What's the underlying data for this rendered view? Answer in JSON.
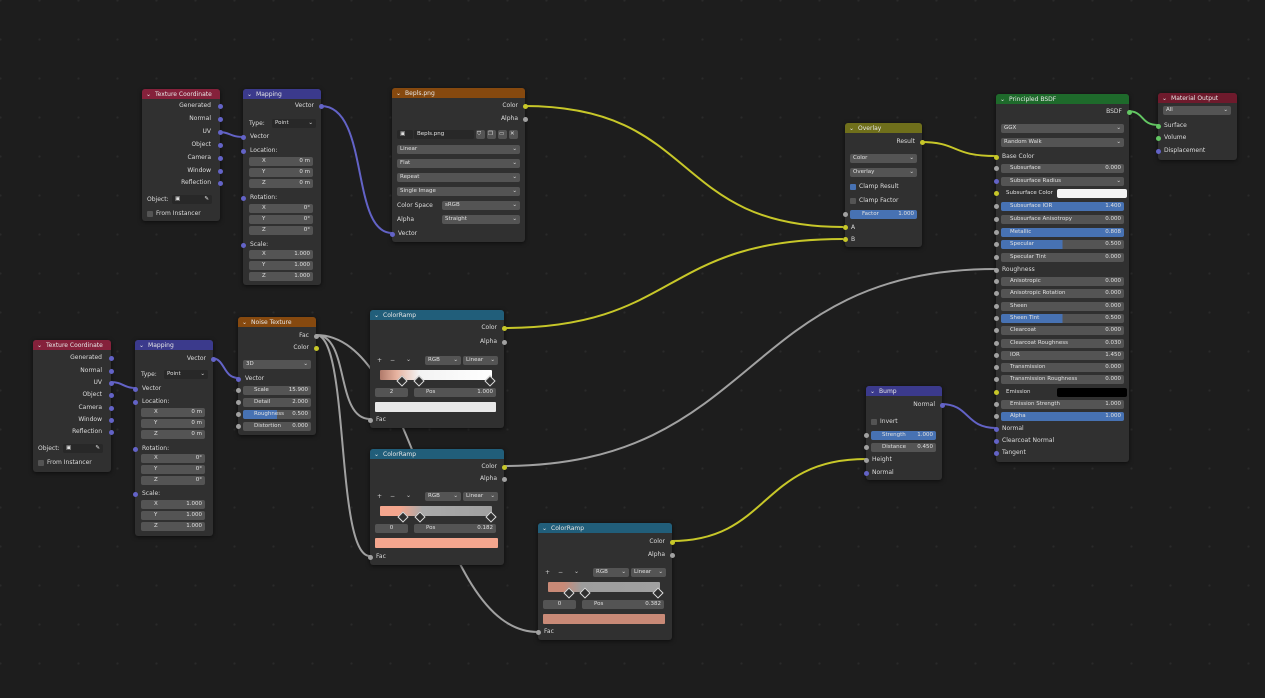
{
  "nodes": {
    "tc1": {
      "title": "Texture Coordinate",
      "outputs": [
        "Generated",
        "Normal",
        "UV",
        "Object",
        "Camera",
        "Window",
        "Reflection"
      ],
      "object_label": "Object:",
      "from_instancer": "From Instancer"
    },
    "mp1": {
      "title": "Mapping",
      "output": "Vector",
      "type_label": "Type:",
      "type_value": "Point",
      "input": "Vector",
      "location": "Location:",
      "rotation": "Rotation:",
      "scale": "Scale:",
      "loc": [
        [
          "X",
          "0 m"
        ],
        [
          "Y",
          "0 m"
        ],
        [
          "Z",
          "0 m"
        ]
      ],
      "rot": [
        [
          "X",
          "0°"
        ],
        [
          "Y",
          "0°"
        ],
        [
          "Z",
          "0°"
        ]
      ],
      "scl": [
        [
          "X",
          "1.000"
        ],
        [
          "Y",
          "1.000"
        ],
        [
          "Z",
          "1.000"
        ]
      ]
    },
    "img": {
      "title": "Bepls.png",
      "out_color": "Color",
      "out_alpha": "Alpha",
      "image_name": "Bepls.png",
      "interp": "Linear",
      "proj": "Flat",
      "ext": "Repeat",
      "source": "Single Image",
      "cs_label": "Color Space",
      "cs_value": "sRGB",
      "alpha_label": "Alpha",
      "alpha_value": "Straight",
      "input": "Vector"
    },
    "overlay": {
      "title": "Overlay",
      "out": "Result",
      "mode1": "Color",
      "mode2": "Overlay",
      "clamp_result": "Clamp Result",
      "clamp_factor": "Clamp Factor",
      "factor_label": "Factor",
      "factor_value": "1.000",
      "in_a": "A",
      "in_b": "B"
    },
    "bsdf": {
      "title": "Principled BSDF",
      "out": "BSDF",
      "dist": "GGX",
      "sss_method": "Random Walk",
      "base_color": "Base Color",
      "rows": [
        [
          "Subsurface",
          "0.000",
          "n"
        ],
        [
          "Subsurface Radius",
          "",
          "d"
        ],
        [
          "Subsurface Color",
          "",
          "w"
        ],
        [
          "Subsurface IOR",
          "1.400",
          "b"
        ],
        [
          "Subsurface Anisotropy",
          "0.000",
          "n"
        ],
        [
          "Metallic",
          "0.808",
          "b"
        ],
        [
          "Specular",
          "0.500",
          "h"
        ],
        [
          "Specular Tint",
          "0.000",
          "n"
        ]
      ],
      "roughness": "Roughness",
      "rows2": [
        [
          "Anisotropic",
          "0.000",
          "n"
        ],
        [
          "Anisotropic Rotation",
          "0.000",
          "n"
        ],
        [
          "Sheen",
          "0.000",
          "n"
        ],
        [
          "Sheen Tint",
          "0.500",
          "h"
        ],
        [
          "Clearcoat",
          "0.000",
          "n"
        ],
        [
          "Clearcoat Roughness",
          "0.030",
          "n"
        ],
        [
          "IOR",
          "1.450",
          "n"
        ],
        [
          "Transmission",
          "0.000",
          "n"
        ],
        [
          "Transmission Roughness",
          "0.000",
          "n"
        ],
        [
          "Emission",
          "",
          "k"
        ],
        [
          "Emission Strength",
          "1.000",
          "n"
        ],
        [
          "Alpha",
          "1.000",
          "b"
        ]
      ],
      "normal": "Normal",
      "clearcoat_normal": "Clearcoat Normal",
      "tangent": "Tangent"
    },
    "matout": {
      "title": "Material Output",
      "target": "All",
      "surface": "Surface",
      "volume": "Volume",
      "displacement": "Displacement"
    },
    "tc2": {
      "title": "Texture Coordinate",
      "outputs": [
        "Generated",
        "Normal",
        "UV",
        "Object",
        "Camera",
        "Window",
        "Reflection"
      ],
      "object_label": "Object:",
      "from_instancer": "From Instancer"
    },
    "mp2": {
      "title": "Mapping",
      "output": "Vector",
      "type_label": "Type:",
      "type_value": "Point",
      "input": "Vector",
      "location": "Location:",
      "rotation": "Rotation:",
      "scale": "Scale:",
      "loc": [
        [
          "X",
          "0 m"
        ],
        [
          "Y",
          "0 m"
        ],
        [
          "Z",
          "0 m"
        ]
      ],
      "rot": [
        [
          "X",
          "0°"
        ],
        [
          "Y",
          "0°"
        ],
        [
          "Z",
          "0°"
        ]
      ],
      "scl": [
        [
          "X",
          "1.000"
        ],
        [
          "Y",
          "1.000"
        ],
        [
          "Z",
          "1.000"
        ]
      ]
    },
    "noise": {
      "title": "Noise Texture",
      "out_fac": "Fac",
      "out_color": "Color",
      "dim": "3D",
      "input": "Vector",
      "scale": [
        "Scale",
        "15.900"
      ],
      "detail": [
        "Detail",
        "2.000"
      ],
      "roughness": [
        "Roughness",
        "0.500"
      ],
      "distortion": [
        "Distortion",
        "0.000"
      ]
    },
    "ramp1": {
      "title": "ColorRamp",
      "out_color": "Color",
      "out_alpha": "Alpha",
      "mode": "RGB",
      "interp": "Linear",
      "index": "2",
      "pos_label": "Pos",
      "pos_value": "1.000",
      "input": "Fac"
    },
    "ramp2": {
      "title": "ColorRamp",
      "out_color": "Color",
      "out_alpha": "Alpha",
      "mode": "RGB",
      "interp": "Linear",
      "index": "0",
      "pos_label": "Pos",
      "pos_value": "0.182",
      "input": "Fac"
    },
    "ramp3": {
      "title": "ColorRamp",
      "out_color": "Color",
      "out_alpha": "Alpha",
      "mode": "RGB",
      "interp": "Linear",
      "index": "0",
      "pos_label": "Pos",
      "pos_value": "0.382",
      "input": "Fac"
    },
    "bump": {
      "title": "Bump",
      "out": "Normal",
      "invert": "Invert",
      "strength": [
        "Strength",
        "1.000"
      ],
      "distance": [
        "Distance",
        "0.450"
      ],
      "height": "Height",
      "normal": "Normal"
    }
  },
  "colors": {
    "yellow_link": "#c7c729",
    "gray_link": "#a1a1a1",
    "violet_link": "#6363c7",
    "green_link": "#63c763",
    "accent": "#4772b3"
  }
}
